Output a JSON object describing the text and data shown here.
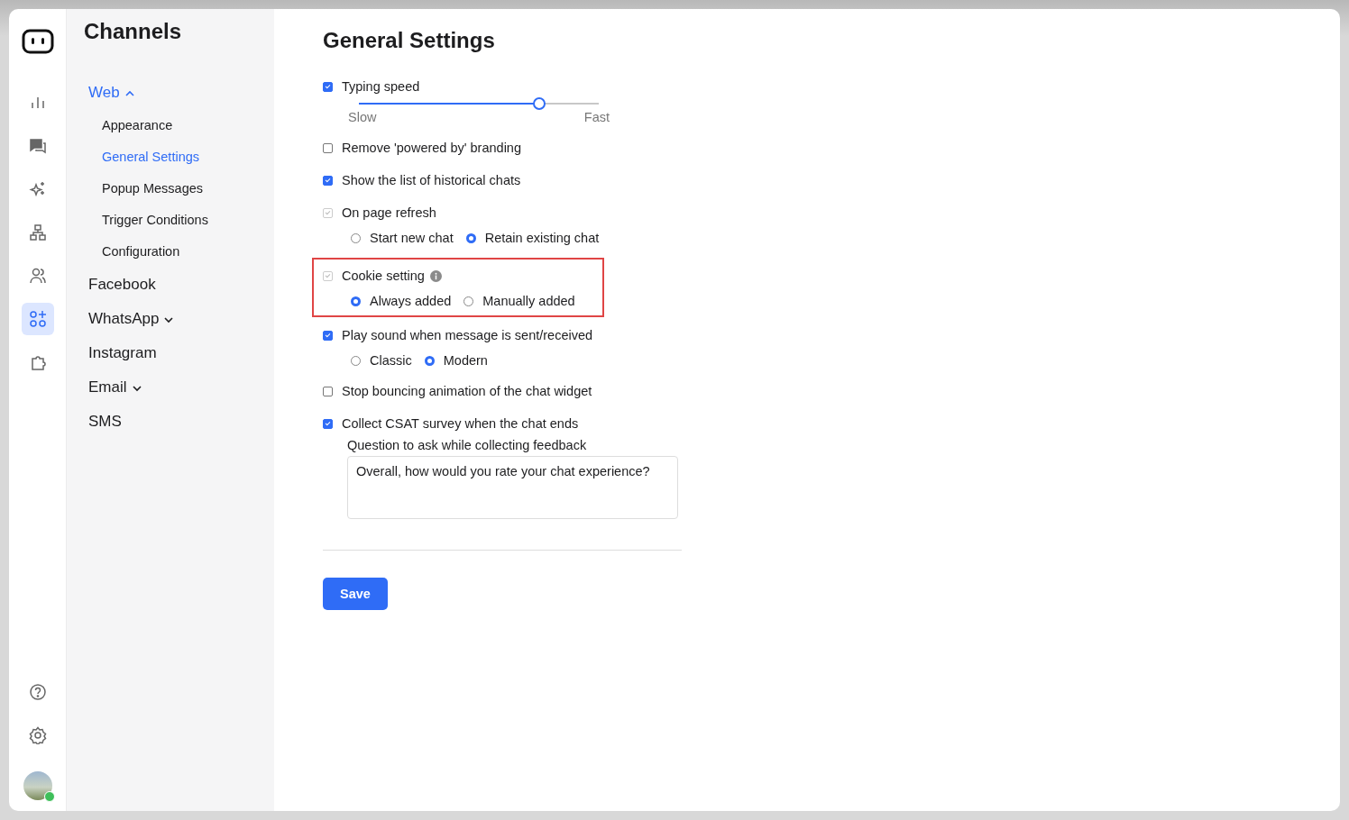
{
  "rail": {
    "top": [
      {
        "selected": false
      },
      {
        "selected": false
      },
      {
        "selected": false
      },
      {
        "selected": false
      },
      {
        "selected": false
      },
      {
        "selected": true
      },
      {
        "selected": false
      }
    ],
    "bottom": [
      {
        "selected": false
      },
      {
        "selected": false
      }
    ],
    "avatar": {
      "online": true
    }
  },
  "sidebar": {
    "title": "Channels",
    "items": [
      {
        "label": "Web",
        "selected": true,
        "expanded": true,
        "children": [
          {
            "label": "Appearance",
            "selected": false
          },
          {
            "label": "General Settings",
            "selected": true
          },
          {
            "label": "Popup Messages",
            "selected": false
          },
          {
            "label": "Trigger Conditions",
            "selected": false
          },
          {
            "label": "Configuration",
            "selected": false
          }
        ]
      },
      {
        "label": "Facebook",
        "selected": false
      },
      {
        "label": "WhatsApp",
        "selected": false,
        "expanded": false
      },
      {
        "label": "Instagram",
        "selected": false
      },
      {
        "label": "Email",
        "selected": false,
        "expanded": false
      },
      {
        "label": "SMS",
        "selected": false
      }
    ]
  },
  "main": {
    "title": "General Settings",
    "settings": [
      {
        "label": "Typing speed",
        "checked": true,
        "disabled": false,
        "slider": {
          "level": 0.75,
          "min_label": "Slow",
          "max_label": "Fast"
        }
      },
      {
        "label": "Remove 'powered by' branding",
        "checked": false,
        "disabled": false
      },
      {
        "label": "Show the list of historical chats",
        "checked": true,
        "disabled": false
      },
      {
        "label": "On page refresh",
        "checked": true,
        "disabled": true,
        "options": [
          {
            "label": "Start new chat",
            "selected": false
          },
          {
            "label": "Retain existing chat",
            "selected": true
          }
        ]
      },
      {
        "label": "Cookie setting",
        "checked": true,
        "disabled": true,
        "info": true,
        "highlighted": true,
        "options": [
          {
            "label": "Always added",
            "selected": true
          },
          {
            "label": "Manually added",
            "selected": false
          }
        ]
      },
      {
        "label": "Play sound when message is sent/received",
        "checked": true,
        "disabled": false,
        "options": [
          {
            "label": "Classic",
            "selected": false
          },
          {
            "label": "Modern",
            "selected": true
          }
        ]
      },
      {
        "label": "Stop bouncing animation of the chat widget",
        "checked": false,
        "disabled": false
      },
      {
        "label": "Collect CSAT survey when the chat ends",
        "checked": true,
        "disabled": false,
        "feedback": {
          "label": "Question to ask while collecting feedback",
          "value": "Overall, how would you rate your chat experience?"
        }
      }
    ],
    "save": "Save"
  }
}
